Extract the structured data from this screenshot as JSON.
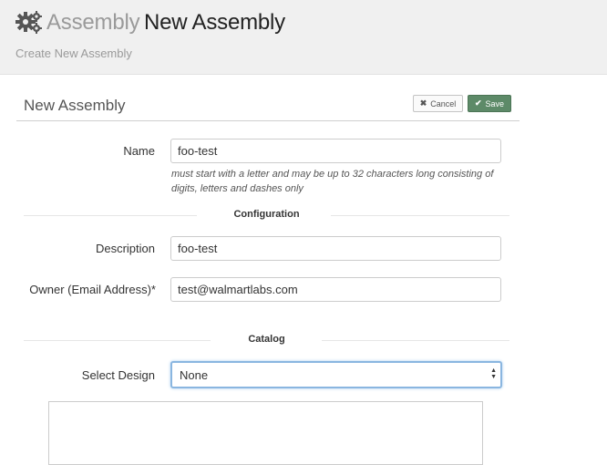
{
  "header": {
    "brand": "Assembly",
    "title": "New Assembly",
    "subnav": "Create New Assembly",
    "icon": "gear-icon"
  },
  "form": {
    "title": "New Assembly",
    "cancel_label": "Cancel",
    "save_label": "Save",
    "name": {
      "label": "Name",
      "value": "foo-test",
      "help": "must start with a letter and may be up to 32 characters long consisting of digits, letters and dashes only"
    },
    "sections": {
      "configuration": "Configuration",
      "catalog": "Catalog"
    },
    "description": {
      "label": "Description",
      "value": "foo-test"
    },
    "owner": {
      "label": "Owner (Email Address)*",
      "value": "test@walmartlabs.com"
    },
    "design": {
      "label": "Select Design",
      "selected": "None"
    }
  },
  "colors": {
    "header_bg": "#f0f0f0",
    "save_button": "#5d8a68",
    "focus_border": "#8ab6e0"
  }
}
